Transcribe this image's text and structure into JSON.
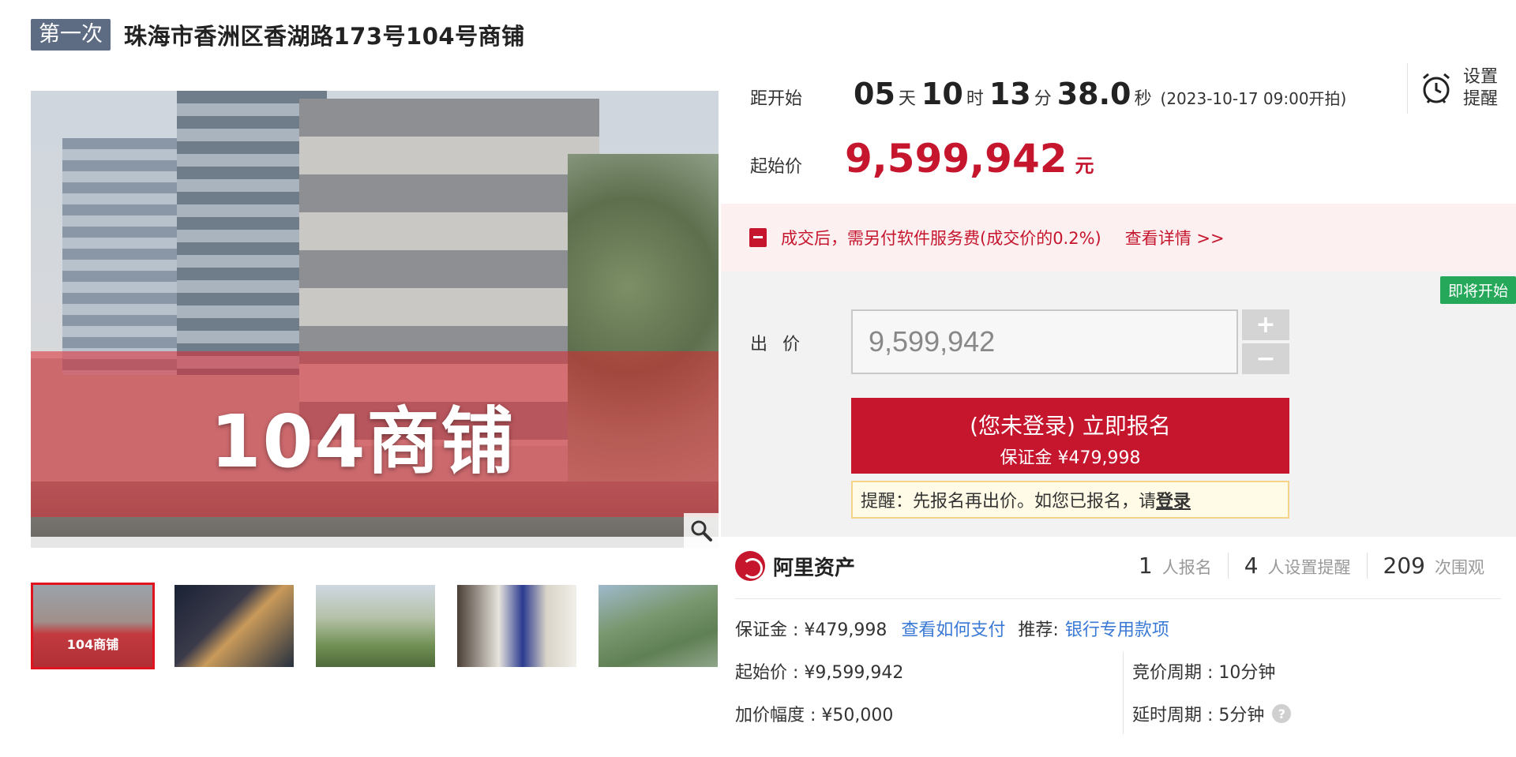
{
  "header": {
    "round_badge": "第一次",
    "title": "珠海市香洲区香湖路173号104号商铺"
  },
  "gallery": {
    "main_image_label": "104商铺",
    "zoom_icon": "magnifier-icon",
    "thumbnails": [
      {
        "caption": "104商铺",
        "active": true
      },
      {
        "caption": "",
        "active": false
      },
      {
        "caption": "",
        "active": false
      },
      {
        "caption": "",
        "active": false
      },
      {
        "caption": "",
        "active": false
      }
    ]
  },
  "countdown": {
    "label": "距开始",
    "days": "05",
    "days_unit": "天",
    "hours": "10",
    "hours_unit": "时",
    "minutes": "13",
    "minutes_unit": "分",
    "seconds": "38.0",
    "seconds_unit": "秒",
    "start_time": "(2023-10-17 09:00开拍)"
  },
  "reminder": {
    "icon": "alarm-clock-icon",
    "line1": "设置",
    "line2": "提醒"
  },
  "start_price": {
    "label": "起始价",
    "value": "9,599,942",
    "unit": "元"
  },
  "fee_notice": {
    "icon": "gift-icon",
    "text": "成交后，需另付软件服务费(成交价的0.2%)",
    "link": "查看详情 >>"
  },
  "bid": {
    "status_tag": "即将开始",
    "label": "出 价",
    "input_value": "9,599,942",
    "plus": "+",
    "minus": "−",
    "signup_main": "(您未登录) 立即报名",
    "signup_sub": "保证金 ¥479,998",
    "tip_prefix": "提醒：先报名再出价。如您已报名，请",
    "tip_link": "登录"
  },
  "platform": {
    "name": "阿里资产",
    "logo_icon": "ali-asset-logo-icon"
  },
  "stats": [
    {
      "num": "1",
      "label": "人报名"
    },
    {
      "num": "4",
      "label": "人设置提醒"
    },
    {
      "num": "209",
      "label": "次围观"
    }
  ],
  "info": {
    "deposit": "保证金 : ¥479,998",
    "how_to_pay": "查看如何支付",
    "recommend_label": "推荐:",
    "recommend_link": "银行专用款项",
    "start_price": "起始价 : ¥9,599,942",
    "bid_cycle": "竞价周期 : 10分钟",
    "increment": "加价幅度 : ¥50,000",
    "delay_cycle": "延时周期 : 5分钟",
    "help_icon": "question-circle-icon"
  },
  "colors": {
    "accent_red": "#c5162e",
    "status_green": "#26a85a",
    "link_blue": "#3a7ad6",
    "badge_slate": "#5d6c82"
  }
}
